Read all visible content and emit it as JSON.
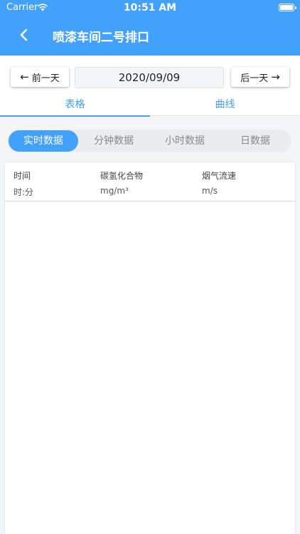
{
  "status_bar": {
    "carrier": "Carrier",
    "time": "10:51 AM"
  },
  "nav": {
    "title": "喷漆车间二号排口"
  },
  "date_nav": {
    "prev_label": "前一天",
    "date": "2020/09/09",
    "next_label": "后一天"
  },
  "tabs": [
    {
      "label": "表格",
      "active": true
    },
    {
      "label": "曲线",
      "active": false
    }
  ],
  "segments": [
    {
      "label": "实时数据",
      "active": true
    },
    {
      "label": "分钟数据",
      "active": false
    },
    {
      "label": "小时数据",
      "active": false
    },
    {
      "label": "日数据",
      "active": false
    }
  ],
  "table": {
    "columns": [
      {
        "name": "时间",
        "unit": "时:分"
      },
      {
        "name": "碳氢化合物",
        "unit": "mg/m³"
      },
      {
        "name": "烟气流速",
        "unit": "m/s"
      }
    ],
    "rows": []
  },
  "colors": {
    "accent": "#42a1fa"
  }
}
